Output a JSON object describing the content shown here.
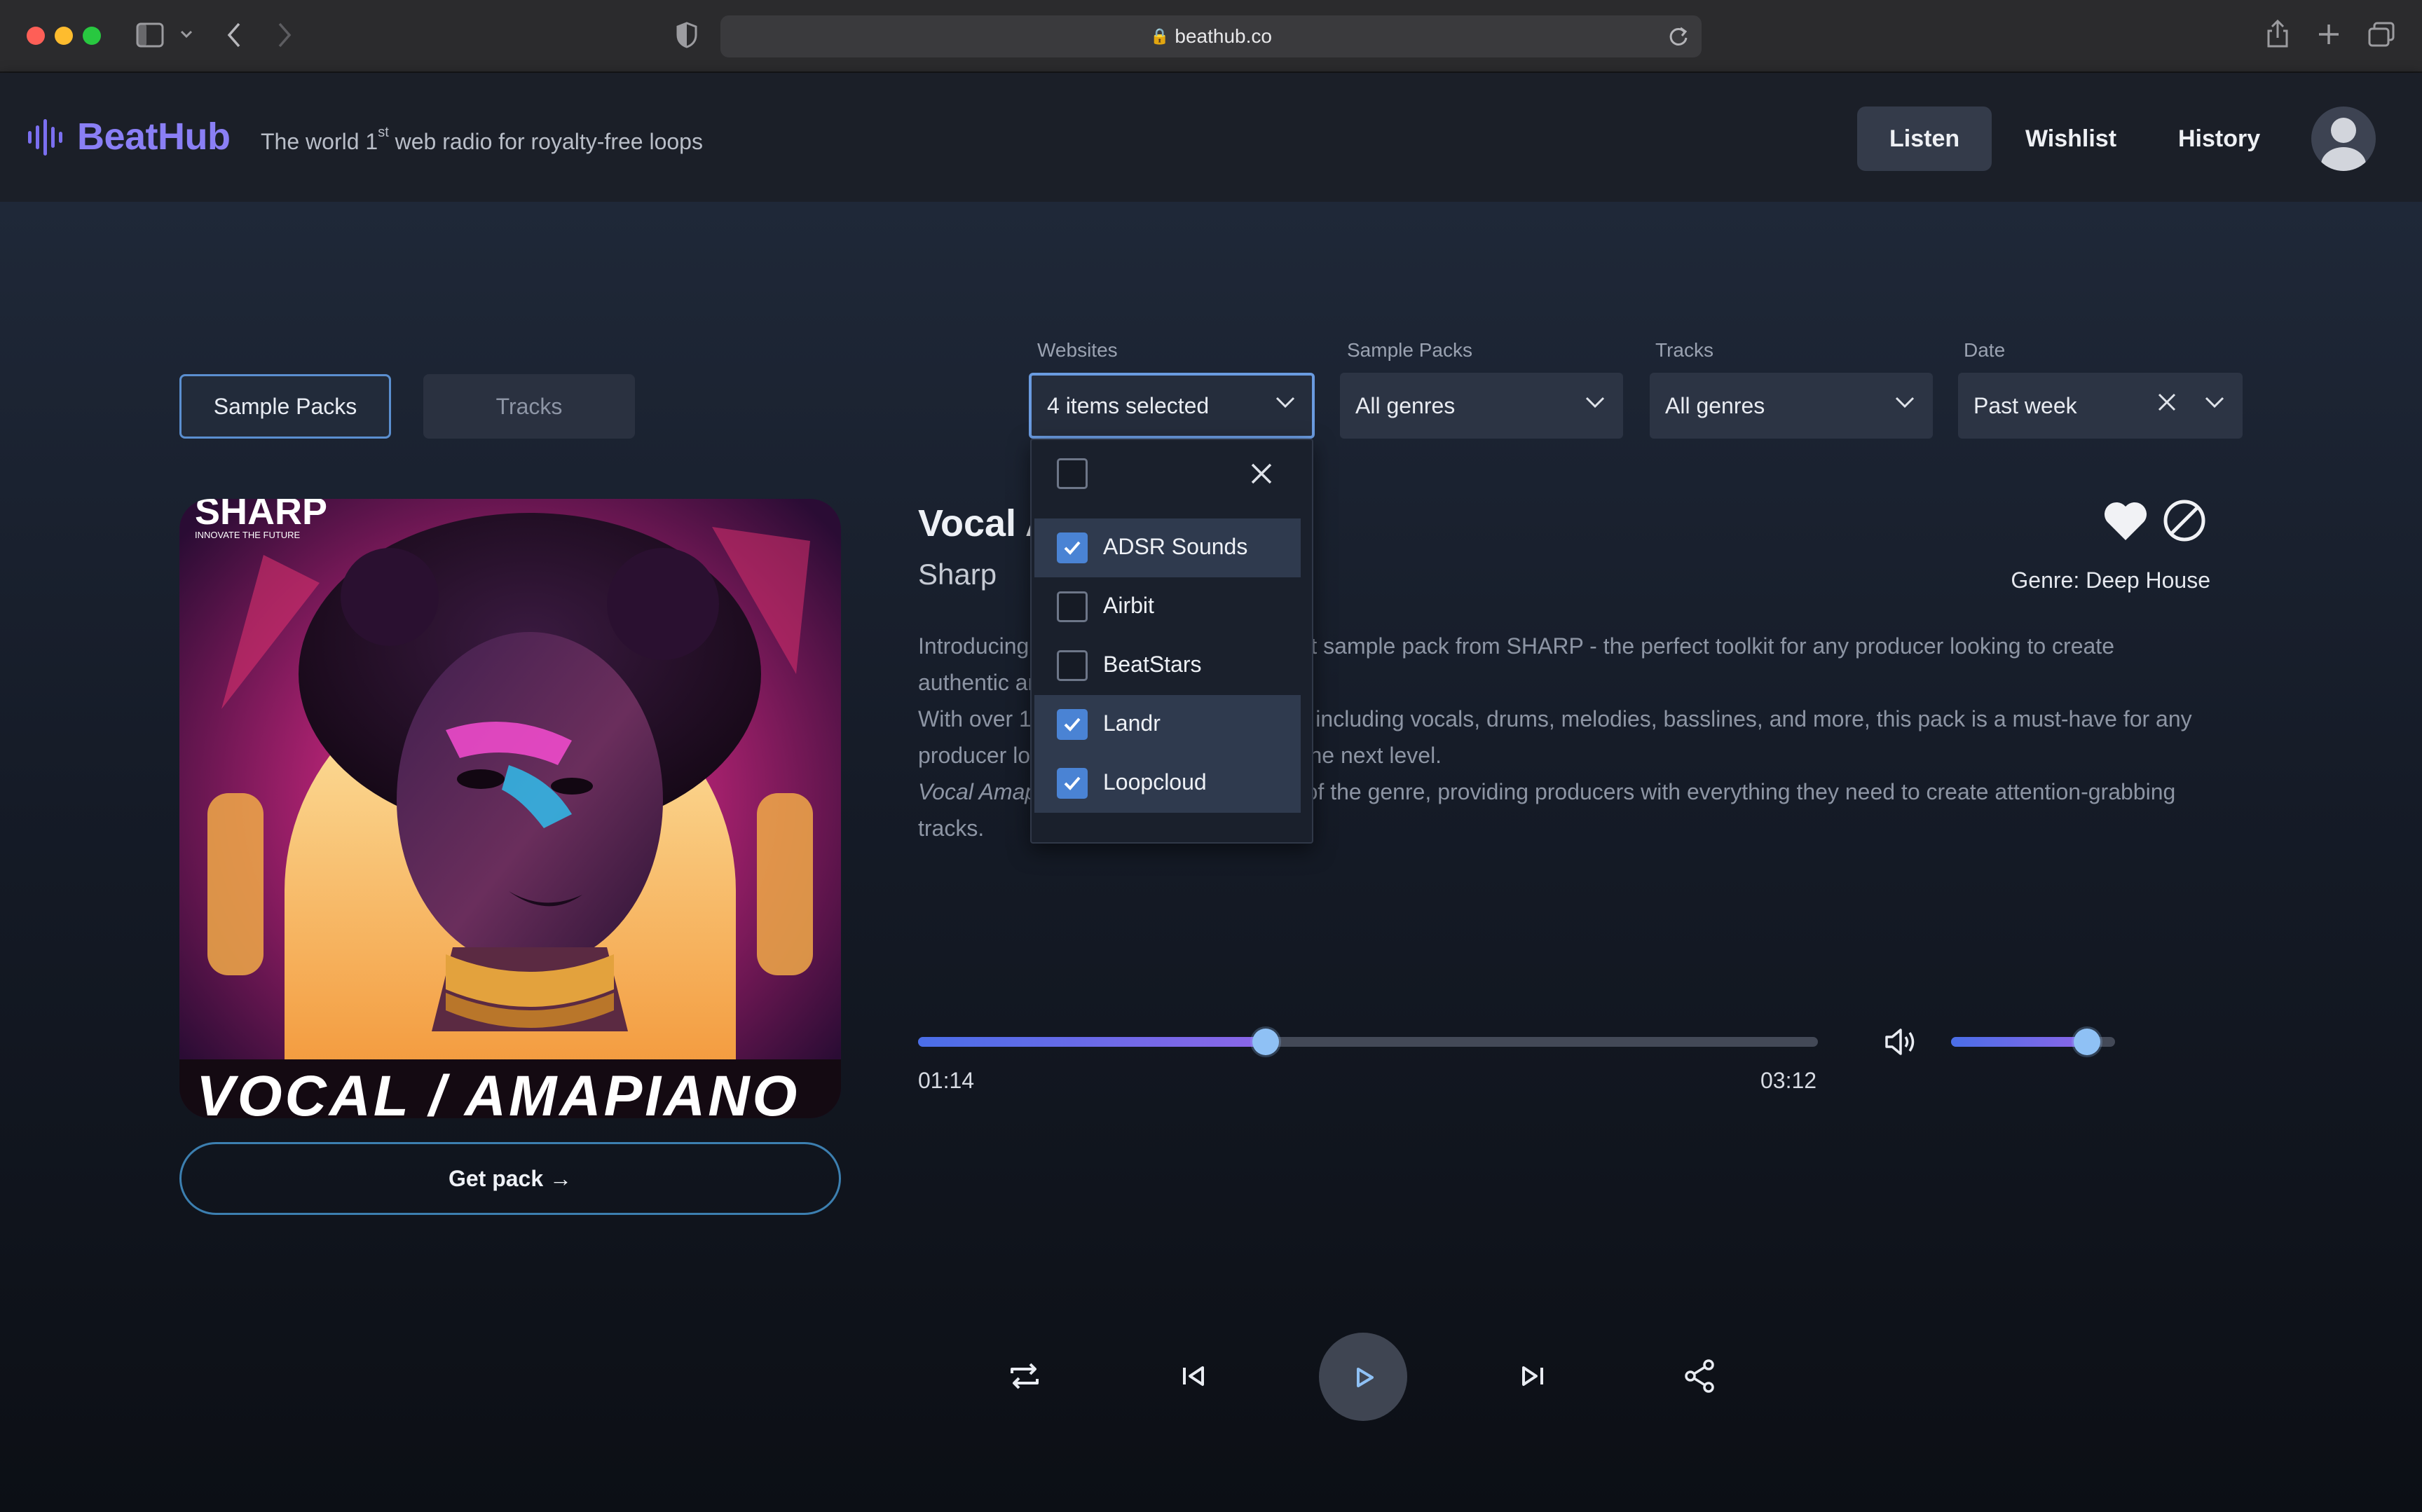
{
  "browser": {
    "url": "beathub.co"
  },
  "header": {
    "brand": "BeatHub",
    "tagline_prefix": "The world 1",
    "tagline_sup": "st",
    "tagline_suffix": " web radio for royalty-free loops",
    "nav": [
      {
        "label": "Listen",
        "active": true
      },
      {
        "label": "Wishlist",
        "active": false
      },
      {
        "label": "History",
        "active": false
      }
    ]
  },
  "modes": [
    {
      "label": "Sample Packs",
      "selected": true
    },
    {
      "label": "Tracks",
      "selected": false
    }
  ],
  "filters": [
    {
      "label": "Websites",
      "value": "4 items selected"
    },
    {
      "label": "Sample Packs",
      "value": "All genres"
    },
    {
      "label": "Tracks",
      "value": "All genres"
    },
    {
      "label": "Date",
      "value": "Past week"
    }
  ],
  "websites_dropdown": {
    "options": [
      {
        "label": "ADSR Sounds",
        "checked": true
      },
      {
        "label": "Airbit",
        "checked": false
      },
      {
        "label": "BeatStars",
        "checked": false
      },
      {
        "label": "Landr",
        "checked": true
      },
      {
        "label": "Loopcloud",
        "checked": true
      }
    ]
  },
  "pack": {
    "cover_top_text": "SHARP",
    "cover_sub_text": "INNOVATE THE FUTURE",
    "cover_bottom_text": "VOCAL / AMAPIANO",
    "get_pack_label": "Get pack →",
    "title": "Vocal Amapiano",
    "artist": "Sharp",
    "genre": "Genre: Deep House",
    "description": {
      "line1": "Introducing Vocal Amapiano, the newest sample pack from SHARP - the perfect toolkit for any producer looking to create authentic and diverse amapiano tracks.",
      "line2": "With over 1 GB of royalty-free samples, including vocals, drums, melodies, basslines, and more, this pack is a must-have for any producer looking to take their music to the next level.",
      "line3_em": "Vocal Amapiano",
      "line3_rest": " captures the essence of the genre, providing producers with everything they need to create attention-grabbing tracks."
    }
  },
  "player": {
    "elapsed": "01:14",
    "duration": "03:12",
    "progress": 0.386,
    "volume": 0.83
  },
  "colors": {
    "brand": "#8a7ff5",
    "accent": "#6a9be0",
    "knob": "#8fc1f5"
  }
}
